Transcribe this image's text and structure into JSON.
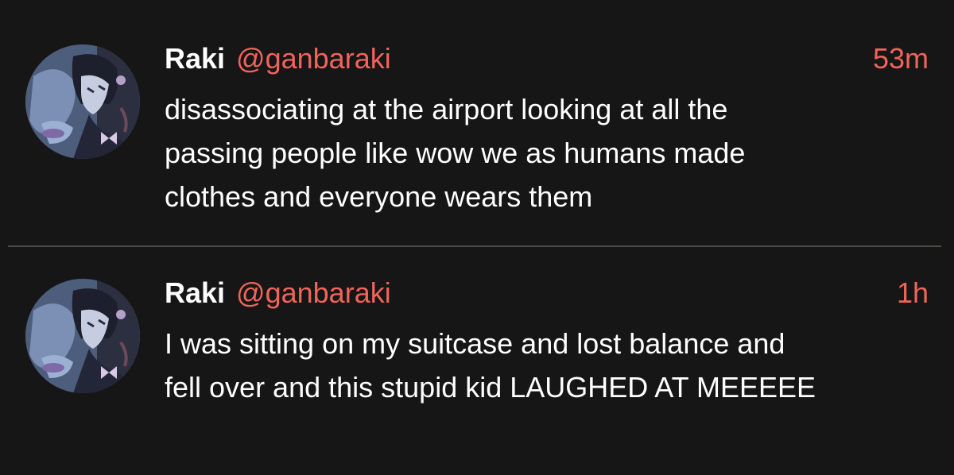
{
  "colors": {
    "background": "#161616",
    "text": "#ffffff",
    "accent": "#f0645a",
    "divider": "#4b4b45"
  },
  "tweets": [
    {
      "name": "Raki",
      "handle": "@ganbaraki",
      "time": "53m",
      "text": "disassociating at the airport looking at all the\npassing people like wow we as humans made\nclothes and everyone wears them",
      "avatar_icon": "anime-girl-avatar"
    },
    {
      "name": "Raki",
      "handle": "@ganbaraki",
      "time": "1h",
      "text": "I was sitting on my suitcase and lost balance and\nfell over and this stupid kid LAUGHED AT MEEEEE",
      "avatar_icon": "anime-girl-avatar"
    }
  ]
}
